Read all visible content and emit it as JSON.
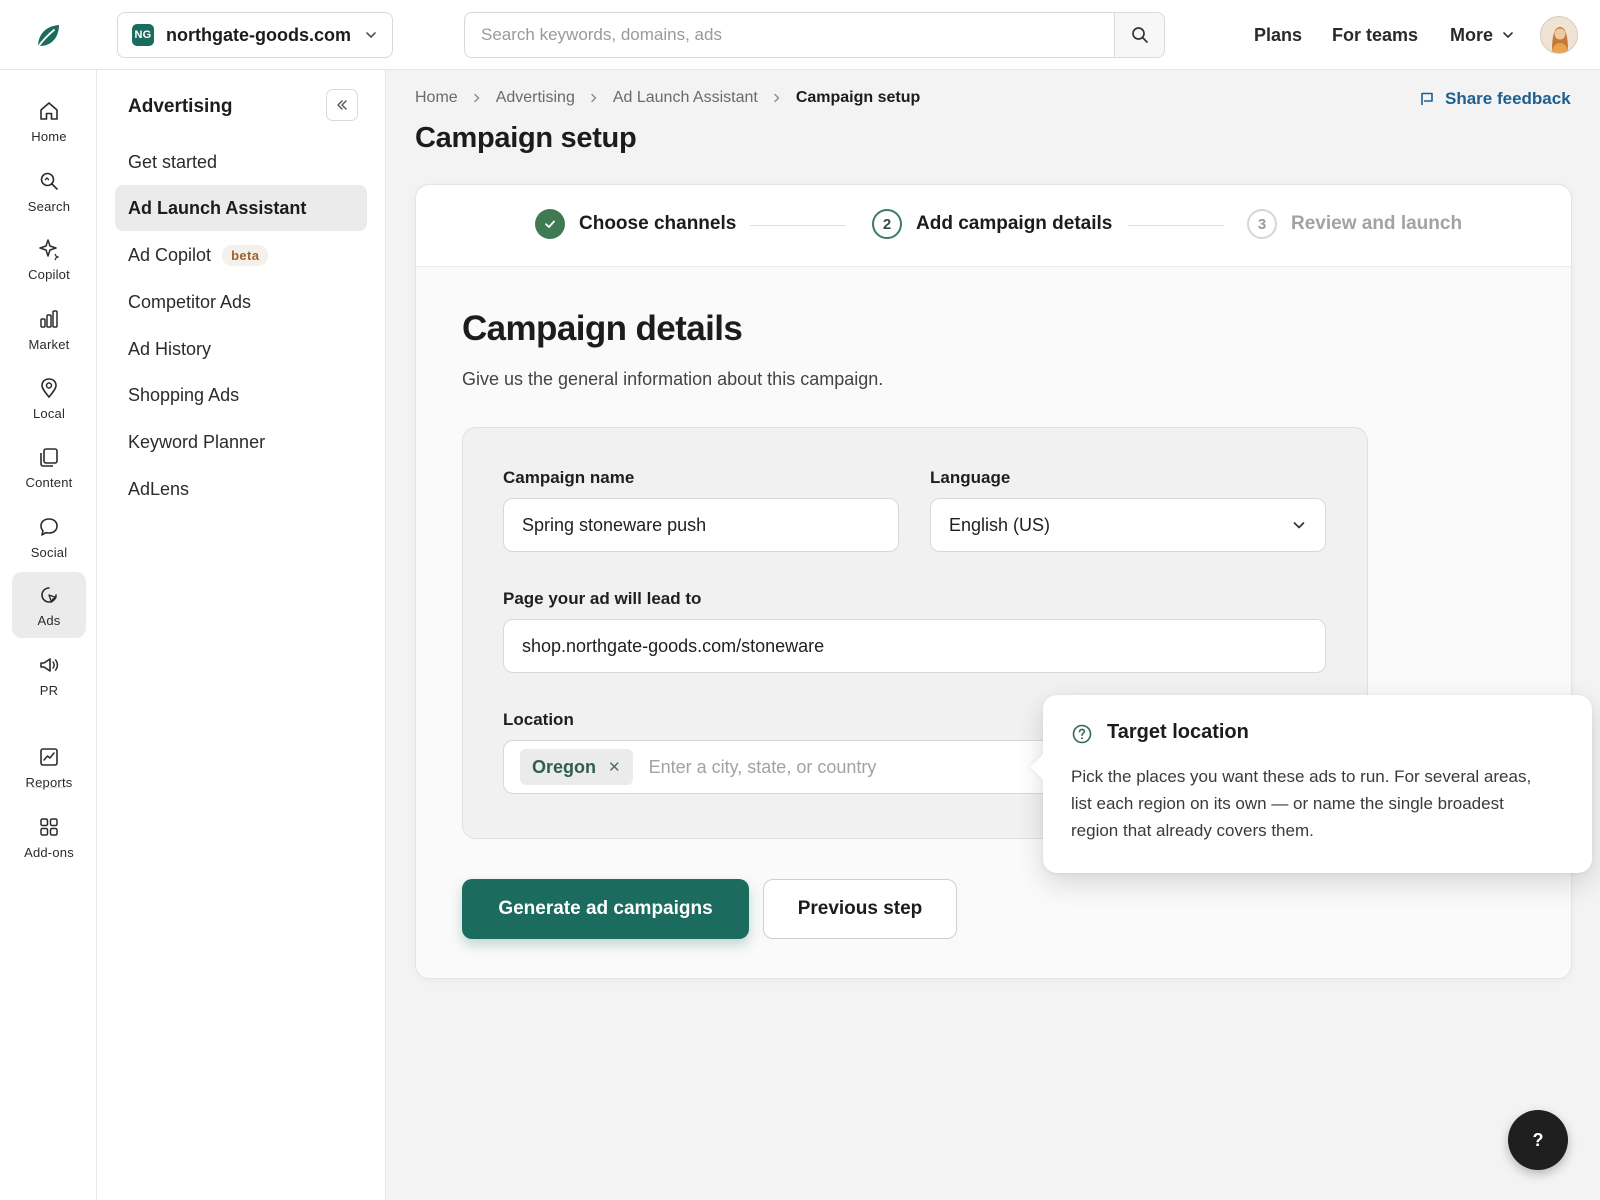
{
  "colors": {
    "brand": "#1c6b5f",
    "link": "#1f5f8f",
    "beta": "#a0622a",
    "step_done": "#3f7a53"
  },
  "header": {
    "domain_badge": "NG",
    "domain": "northgate-goods.com",
    "search_placeholder": "Search keywords, domains, ads",
    "nav": {
      "plans": "Plans",
      "teams": "For teams",
      "more": "More"
    }
  },
  "rail": [
    {
      "label": "Home",
      "icon": "home-icon"
    },
    {
      "label": "Search",
      "icon": "search-icon"
    },
    {
      "label": "Copilot",
      "icon": "sparkle-icon"
    },
    {
      "label": "Market",
      "icon": "bar-chart-icon"
    },
    {
      "label": "Local",
      "icon": "map-pin-icon"
    },
    {
      "label": "Content",
      "icon": "copy-icon"
    },
    {
      "label": "Social",
      "icon": "chat-bubble-icon"
    },
    {
      "label": "Ads",
      "icon": "target-cursor-icon",
      "active": true
    },
    {
      "label": "PR",
      "icon": "megaphone-icon"
    },
    {
      "label": "Reports",
      "icon": "line-chart-icon"
    },
    {
      "label": "Add-ons",
      "icon": "grid-icon"
    }
  ],
  "sidemenu": {
    "title": "Advertising",
    "items": [
      {
        "label": "Get started"
      },
      {
        "label": "Ad Launch Assistant",
        "active": true
      },
      {
        "label": "Ad Copilot",
        "badge": "beta"
      },
      {
        "label": "Competitor Ads"
      },
      {
        "label": "Ad History"
      },
      {
        "label": "Shopping Ads"
      },
      {
        "label": "Keyword Planner"
      },
      {
        "label": "AdLens"
      }
    ]
  },
  "breadcrumb": [
    "Home",
    "Advertising",
    "Ad Launch Assistant",
    "Campaign setup"
  ],
  "share_feedback": "Share feedback",
  "page_title": "Campaign setup",
  "stepper": [
    {
      "number": "1",
      "label": "Choose channels",
      "state": "done"
    },
    {
      "number": "2",
      "label": "Add campaign details",
      "state": "active"
    },
    {
      "number": "3",
      "label": "Review and launch",
      "state": "todo"
    }
  ],
  "section": {
    "title": "Campaign details",
    "subtitle": "Give us the general information about this campaign."
  },
  "form": {
    "campaign_name": {
      "label": "Campaign name",
      "value": "Spring stoneware push"
    },
    "language": {
      "label": "Language",
      "value": "English (US)"
    },
    "landing_page": {
      "label": "Page your ad will lead to",
      "value": "shop.northgate-goods.com/stoneware"
    },
    "location": {
      "label": "Location",
      "chips": [
        "Oregon"
      ],
      "placeholder": "Enter a city, state, or country"
    }
  },
  "buttons": {
    "generate": "Generate ad campaigns",
    "previous": "Previous step"
  },
  "tooltip": {
    "title": "Target location",
    "body": "Pick the places you want these ads to run. For several areas, list each region on its own — or name the single broadest region that already covers them."
  },
  "help_fab": "?"
}
